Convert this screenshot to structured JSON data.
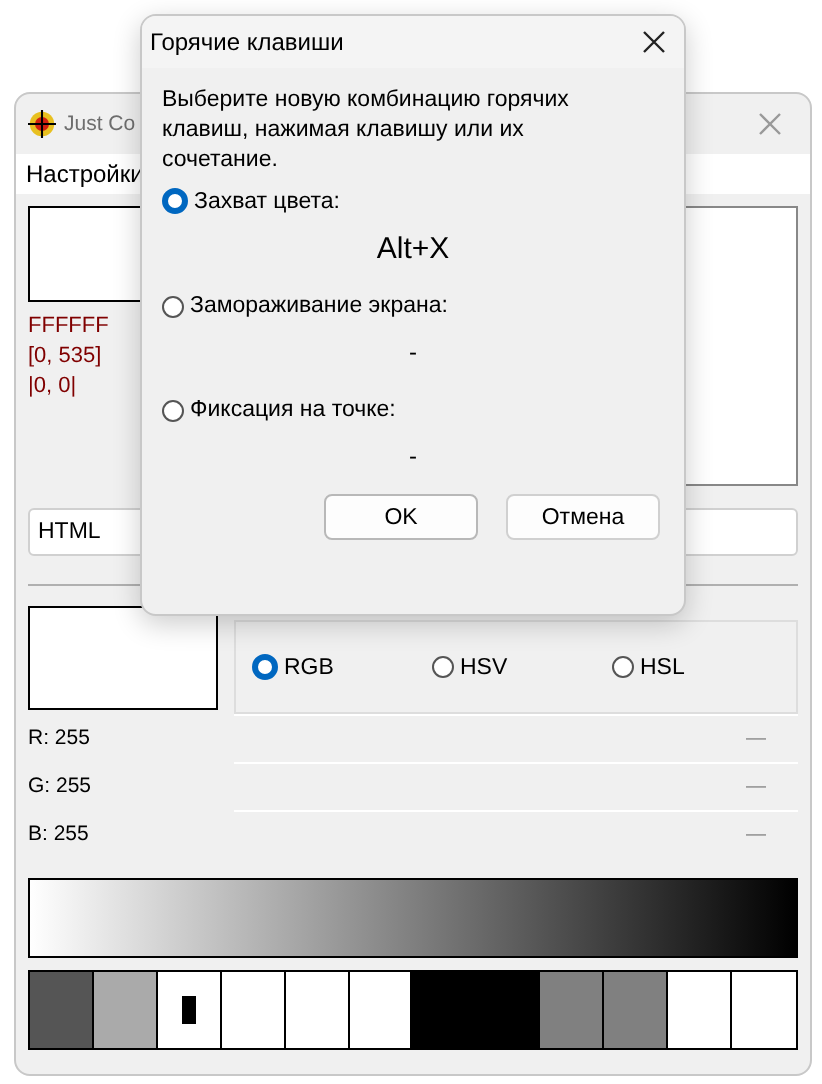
{
  "main_window": {
    "title": "Just Co",
    "menu": [
      "Настройки"
    ],
    "hex": "FFFFFF",
    "position": "[0, 535]",
    "offset": "|0, 0|",
    "format_field": {
      "value": "HTML"
    },
    "color_models": [
      {
        "label": "RGB",
        "selected": true
      },
      {
        "label": "HSV",
        "selected": false
      },
      {
        "label": "HSL",
        "selected": false
      }
    ],
    "channels": [
      {
        "label": "R: 255",
        "reading": "—"
      },
      {
        "label": "G: 255",
        "reading": "—"
      },
      {
        "label": "B: 255",
        "reading": "—"
      }
    ],
    "swatches": [
      {
        "color": "#555555",
        "marked": false
      },
      {
        "color": "#aaaaaa",
        "marked": false
      },
      {
        "color": "#ffffff",
        "marked": true
      },
      {
        "color": "#ffffff",
        "marked": false
      },
      {
        "color": "#ffffff",
        "marked": false
      },
      {
        "color": "#ffffff",
        "marked": false
      },
      {
        "color": "#000000",
        "marked": false,
        "wide": true
      },
      {
        "color": "#808080",
        "marked": false
      },
      {
        "color": "#808080",
        "marked": false
      },
      {
        "color": "#ffffff",
        "marked": false
      },
      {
        "color": "#ffffff",
        "marked": false
      }
    ]
  },
  "dialog": {
    "title": "Горячие клавиши",
    "instruction": "Выберите новую комбинацию горячих клавиш, нажимая клавишу или их сочетание.",
    "options": [
      {
        "label": "Захват цвета:",
        "selected": true,
        "hotkey": "Alt+X"
      },
      {
        "label": "Замораживание экрана:",
        "selected": false,
        "hotkey": "-"
      },
      {
        "label": "Фиксация на точке:",
        "selected": false,
        "hotkey": "-"
      }
    ],
    "buttons": [
      {
        "label": "OK",
        "kind": "primary"
      },
      {
        "label": "Отмена",
        "kind": "secondary"
      }
    ]
  }
}
